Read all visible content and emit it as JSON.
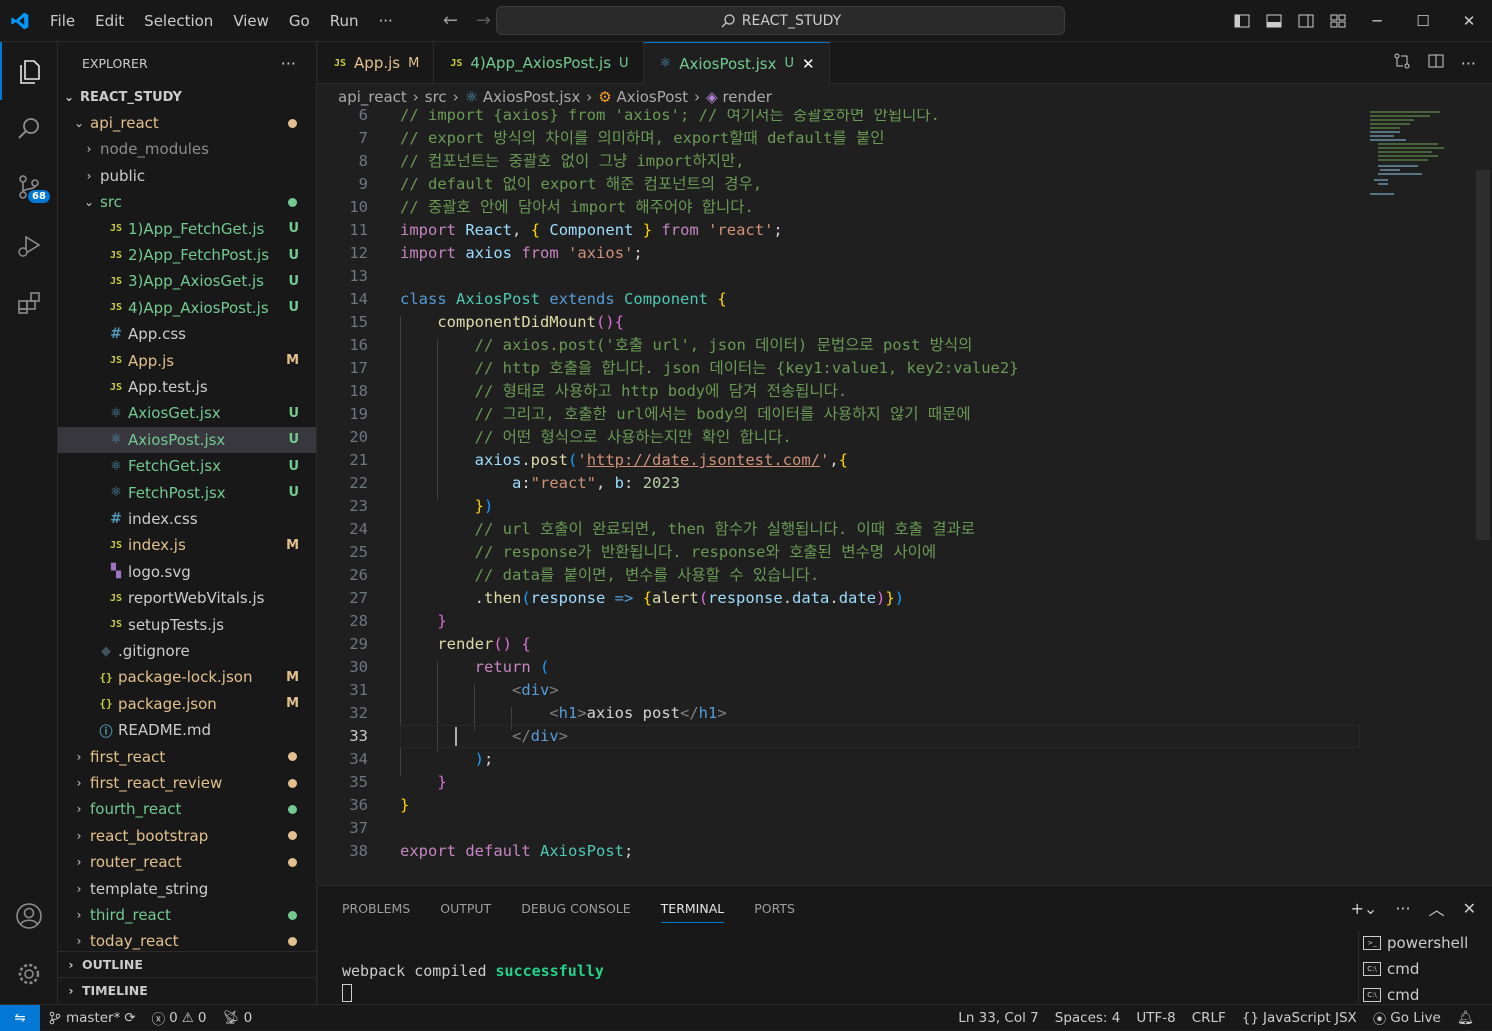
{
  "menu": [
    "File",
    "Edit",
    "Selection",
    "View",
    "Go",
    "Run",
    "···"
  ],
  "search": {
    "text": "REACT_STUDY"
  },
  "activity": {
    "scm_badge": "68"
  },
  "explorer": {
    "title": "EXPLORER",
    "more": "···",
    "root": "REACT_STUDY",
    "tree": [
      {
        "label": "api_react",
        "type": "folder-open",
        "indent": 1,
        "status": "dot",
        "status_color": "#e2c08d",
        "color": "c-m"
      },
      {
        "label": "node_modules",
        "type": "folder",
        "indent": 2,
        "color": "c-dim"
      },
      {
        "label": "public",
        "type": "folder",
        "indent": 2,
        "color": ""
      },
      {
        "label": "src",
        "type": "folder-open",
        "indent": 2,
        "status": "dot",
        "status_color": "#73c991",
        "color": "c-u"
      },
      {
        "label": "1)App_FetchGet.js",
        "type": "js",
        "indent": 3,
        "status": "U",
        "color": "c-u"
      },
      {
        "label": "2)App_FetchPost.js",
        "type": "js",
        "indent": 3,
        "status": "U",
        "color": "c-u"
      },
      {
        "label": "3)App_AxiosGet.js",
        "type": "js",
        "indent": 3,
        "status": "U",
        "color": "c-u"
      },
      {
        "label": "4)App_AxiosPost.js",
        "type": "js",
        "indent": 3,
        "status": "U",
        "color": "c-u"
      },
      {
        "label": "App.css",
        "type": "css",
        "indent": 3,
        "color": ""
      },
      {
        "label": "App.js",
        "type": "js",
        "indent": 3,
        "status": "M",
        "color": "c-m"
      },
      {
        "label": "App.test.js",
        "type": "js-test",
        "indent": 3,
        "color": ""
      },
      {
        "label": "AxiosGet.jsx",
        "type": "react",
        "indent": 3,
        "status": "U",
        "color": "c-u"
      },
      {
        "label": "AxiosPost.jsx",
        "type": "react",
        "indent": 3,
        "status": "U",
        "color": "c-u",
        "selected": true
      },
      {
        "label": "FetchGet.jsx",
        "type": "react",
        "indent": 3,
        "status": "U",
        "color": "c-u"
      },
      {
        "label": "FetchPost.jsx",
        "type": "react",
        "indent": 3,
        "status": "U",
        "color": "c-u"
      },
      {
        "label": "index.css",
        "type": "css",
        "indent": 3,
        "color": ""
      },
      {
        "label": "index.js",
        "type": "js",
        "indent": 3,
        "status": "M",
        "color": "c-m"
      },
      {
        "label": "logo.svg",
        "type": "svg",
        "indent": 3,
        "color": ""
      },
      {
        "label": "reportWebVitals.js",
        "type": "js",
        "indent": 3,
        "color": ""
      },
      {
        "label": "setupTests.js",
        "type": "js",
        "indent": 3,
        "color": ""
      },
      {
        "label": ".gitignore",
        "type": "git",
        "indent": 2,
        "color": ""
      },
      {
        "label": "package-lock.json",
        "type": "json",
        "indent": 2,
        "status": "M",
        "color": "c-m"
      },
      {
        "label": "package.json",
        "type": "json",
        "indent": 2,
        "status": "M",
        "color": "c-m"
      },
      {
        "label": "README.md",
        "type": "info",
        "indent": 2,
        "color": ""
      },
      {
        "label": "first_react",
        "type": "folder",
        "indent": 1,
        "status": "dot",
        "status_color": "#e2c08d",
        "color": "c-m"
      },
      {
        "label": "first_react_review",
        "type": "folder",
        "indent": 1,
        "status": "dot",
        "status_color": "#e2c08d",
        "color": "c-m"
      },
      {
        "label": "fourth_react",
        "type": "folder",
        "indent": 1,
        "status": "dot",
        "status_color": "#73c991",
        "color": "c-u"
      },
      {
        "label": "react_bootstrap",
        "type": "folder",
        "indent": 1,
        "status": "dot",
        "status_color": "#e2c08d",
        "color": "c-m"
      },
      {
        "label": "router_react",
        "type": "folder",
        "indent": 1,
        "status": "dot",
        "status_color": "#e2c08d",
        "color": "c-m"
      },
      {
        "label": "template_string",
        "type": "folder",
        "indent": 1,
        "color": ""
      },
      {
        "label": "third_react",
        "type": "folder",
        "indent": 1,
        "status": "dot",
        "status_color": "#73c991",
        "color": "c-u"
      },
      {
        "label": "today_react",
        "type": "folder",
        "indent": 1,
        "status": "dot",
        "status_color": "#e2c08d",
        "color": "c-m"
      }
    ],
    "outline": "OUTLINE",
    "timeline": "TIMELINE"
  },
  "tabs": [
    {
      "icon": "JS",
      "label": "App.js",
      "status": "M",
      "status_color": "#e2c08d",
      "active": false
    },
    {
      "icon": "JS",
      "label": "4)App_AxiosPost.js",
      "status": "U",
      "status_color": "#73c991",
      "active": false
    },
    {
      "icon": "⚛",
      "label": "AxiosPost.jsx",
      "status": "U",
      "status_color": "#73c991",
      "active": true
    }
  ],
  "breadcrumb": [
    "api_react",
    "src",
    "AxiosPost.jsx",
    "AxiosPost",
    "render"
  ],
  "editor": {
    "current_line": "33",
    "lines": [
      {
        "n": "6",
        "tokens": [
          [
            "t-com",
            "// import {axios} from 'axios'; // 여기서는 중괄호하면 안됩니다."
          ]
        ]
      },
      {
        "n": "7",
        "tokens": [
          [
            "t-com",
            "// export 방식의 차이를 의미하며, export할때 default를 붙인"
          ]
        ]
      },
      {
        "n": "8",
        "tokens": [
          [
            "t-com",
            "// 컴포넌트는 중괄호 없이 그냥 import하지만,"
          ]
        ]
      },
      {
        "n": "9",
        "tokens": [
          [
            "t-com",
            "// default 없이 export 해준 컴포넌트의 경우,"
          ]
        ]
      },
      {
        "n": "10",
        "tokens": [
          [
            "t-com",
            "// 중괄호 안에 담아서 import 해주어야 합니다."
          ]
        ]
      },
      {
        "n": "11",
        "tokens": [
          [
            "t-kwc",
            "import"
          ],
          [
            "t-txt",
            " "
          ],
          [
            "t-var",
            "React"
          ],
          [
            "t-txt",
            ", "
          ],
          [
            "t-p1",
            "{"
          ],
          [
            "t-txt",
            " "
          ],
          [
            "t-var",
            "Component"
          ],
          [
            "t-txt",
            " "
          ],
          [
            "t-p1",
            "}"
          ],
          [
            "t-txt",
            " "
          ],
          [
            "t-kwc",
            "from"
          ],
          [
            "t-txt",
            " "
          ],
          [
            "t-str",
            "'react'"
          ],
          [
            "t-txt",
            ";"
          ]
        ]
      },
      {
        "n": "12",
        "tokens": [
          [
            "t-kwc",
            "import"
          ],
          [
            "t-txt",
            " "
          ],
          [
            "t-var",
            "axios"
          ],
          [
            "t-txt",
            " "
          ],
          [
            "t-kwc",
            "from"
          ],
          [
            "t-txt",
            " "
          ],
          [
            "t-str",
            "'axios'"
          ],
          [
            "t-txt",
            ";"
          ]
        ]
      },
      {
        "n": "13",
        "tokens": []
      },
      {
        "n": "14",
        "tokens": [
          [
            "t-kw",
            "class"
          ],
          [
            "t-txt",
            " "
          ],
          [
            "t-cls",
            "AxiosPost"
          ],
          [
            "t-txt",
            " "
          ],
          [
            "t-kw",
            "extends"
          ],
          [
            "t-txt",
            " "
          ],
          [
            "t-cls",
            "Component"
          ],
          [
            "t-txt",
            " "
          ],
          [
            "t-p1",
            "{"
          ]
        ]
      },
      {
        "n": "15",
        "tokens": [
          [
            "t-txt",
            "    "
          ],
          [
            "t-fn",
            "componentDidMount"
          ],
          [
            "t-p2",
            "()"
          ],
          [
            "t-p2",
            "{"
          ]
        ]
      },
      {
        "n": "16",
        "tokens": [
          [
            "t-txt",
            "        "
          ],
          [
            "t-com",
            "// axios.post('호출 url', json 데이터) 문법으로 post 방식의"
          ]
        ]
      },
      {
        "n": "17",
        "tokens": [
          [
            "t-txt",
            "        "
          ],
          [
            "t-com",
            "// http 호출을 합니다. json 데이터는 {key1:value1, key2:value2}"
          ]
        ]
      },
      {
        "n": "18",
        "tokens": [
          [
            "t-txt",
            "        "
          ],
          [
            "t-com",
            "// 형태로 사용하고 http body에 담겨 전송됩니다."
          ]
        ]
      },
      {
        "n": "19",
        "tokens": [
          [
            "t-txt",
            "        "
          ],
          [
            "t-com",
            "// 그리고, 호출한 url에서는 body의 데이터를 사용하지 않기 때문에"
          ]
        ]
      },
      {
        "n": "20",
        "tokens": [
          [
            "t-txt",
            "        "
          ],
          [
            "t-com",
            "// 어떤 형식으로 사용하는지만 확인 합니다."
          ]
        ]
      },
      {
        "n": "21",
        "tokens": [
          [
            "t-txt",
            "        "
          ],
          [
            "t-var",
            "axios"
          ],
          [
            "t-txt",
            "."
          ],
          [
            "t-fn",
            "post"
          ],
          [
            "t-p3",
            "("
          ],
          [
            "t-str",
            "'"
          ],
          [
            "t-link",
            "http://date.jsontest.com/"
          ],
          [
            "t-str",
            "'"
          ],
          [
            "t-txt",
            ","
          ],
          [
            "t-p1",
            "{"
          ]
        ]
      },
      {
        "n": "22",
        "tokens": [
          [
            "t-txt",
            "            "
          ],
          [
            "t-var",
            "a"
          ],
          [
            "t-txt",
            ":"
          ],
          [
            "t-str",
            "\"react\""
          ],
          [
            "t-txt",
            ", "
          ],
          [
            "t-var",
            "b"
          ],
          [
            "t-txt",
            ": "
          ],
          [
            "t-num",
            "2023"
          ]
        ]
      },
      {
        "n": "23",
        "tokens": [
          [
            "t-txt",
            "        "
          ],
          [
            "t-p1",
            "}"
          ],
          [
            "t-p3",
            ")"
          ]
        ]
      },
      {
        "n": "24",
        "tokens": [
          [
            "t-txt",
            "        "
          ],
          [
            "t-com",
            "// url 호출이 완료되면, then 함수가 실행됩니다. 이때 호출 결과로"
          ]
        ]
      },
      {
        "n": "25",
        "tokens": [
          [
            "t-txt",
            "        "
          ],
          [
            "t-com",
            "// response가 반환됩니다. response와 호출된 변수명 사이에"
          ]
        ]
      },
      {
        "n": "26",
        "tokens": [
          [
            "t-txt",
            "        "
          ],
          [
            "t-com",
            "// data를 붙이면, 변수를 사용할 수 있습니다."
          ]
        ]
      },
      {
        "n": "27",
        "tokens": [
          [
            "t-txt",
            "        ."
          ],
          [
            "t-fn",
            "then"
          ],
          [
            "t-p3",
            "("
          ],
          [
            "t-var",
            "response"
          ],
          [
            "t-txt",
            " "
          ],
          [
            "t-kw",
            "=>"
          ],
          [
            "t-txt",
            " "
          ],
          [
            "t-p1",
            "{"
          ],
          [
            "t-fn",
            "alert"
          ],
          [
            "t-p2",
            "("
          ],
          [
            "t-var",
            "response"
          ],
          [
            "t-txt",
            "."
          ],
          [
            "t-var",
            "data"
          ],
          [
            "t-txt",
            "."
          ],
          [
            "t-var",
            "date"
          ],
          [
            "t-p2",
            ")"
          ],
          [
            "t-p1",
            "}"
          ],
          [
            "t-p3",
            ")"
          ]
        ]
      },
      {
        "n": "28",
        "tokens": [
          [
            "t-txt",
            "    "
          ],
          [
            "t-p2",
            "}"
          ]
        ]
      },
      {
        "n": "29",
        "tokens": [
          [
            "t-txt",
            "    "
          ],
          [
            "t-fn",
            "render"
          ],
          [
            "t-p2",
            "()"
          ],
          [
            "t-txt",
            " "
          ],
          [
            "t-p2",
            "{"
          ]
        ]
      },
      {
        "n": "30",
        "tokens": [
          [
            "t-txt",
            "        "
          ],
          [
            "t-kwc",
            "return"
          ],
          [
            "t-txt",
            " "
          ],
          [
            "t-p3",
            "("
          ]
        ]
      },
      {
        "n": "31",
        "tokens": [
          [
            "t-txt",
            "            "
          ],
          [
            "t-tagp",
            "<"
          ],
          [
            "t-tag",
            "div"
          ],
          [
            "t-tagp",
            ">"
          ]
        ]
      },
      {
        "n": "32",
        "tokens": [
          [
            "t-txt",
            "                "
          ],
          [
            "t-tagp",
            "<"
          ],
          [
            "t-tag",
            "h1"
          ],
          [
            "t-tagp",
            ">"
          ],
          [
            "t-txt",
            "axios post"
          ],
          [
            "t-tagp",
            "</"
          ],
          [
            "t-tag",
            "h1"
          ],
          [
            "t-tagp",
            ">"
          ]
        ]
      },
      {
        "n": "33",
        "tokens": [
          [
            "t-txt",
            "            "
          ],
          [
            "t-tagp",
            "</"
          ],
          [
            "t-tag",
            "div"
          ],
          [
            "t-tagp",
            ">"
          ]
        ]
      },
      {
        "n": "34",
        "tokens": [
          [
            "t-txt",
            "        "
          ],
          [
            "t-p3",
            ")"
          ],
          [
            "t-txt",
            ";"
          ]
        ]
      },
      {
        "n": "35",
        "tokens": [
          [
            "t-txt",
            "    "
          ],
          [
            "t-p2",
            "}"
          ]
        ]
      },
      {
        "n": "36",
        "tokens": [
          [
            "t-p1",
            "}"
          ]
        ]
      },
      {
        "n": "37",
        "tokens": []
      },
      {
        "n": "38",
        "tokens": [
          [
            "t-kwc",
            "export"
          ],
          [
            "t-txt",
            " "
          ],
          [
            "t-kwc",
            "default"
          ],
          [
            "t-txt",
            " "
          ],
          [
            "t-cls",
            "AxiosPost"
          ],
          [
            "t-txt",
            ";"
          ]
        ]
      }
    ]
  },
  "panel": {
    "tabs": [
      "PROBLEMS",
      "OUTPUT",
      "DEBUG CONSOLE",
      "TERMINAL",
      "PORTS"
    ],
    "active_tab": "TERMINAL",
    "terminal_text_prefix": "webpack compiled ",
    "terminal_text_success": "successfully",
    "terminals": [
      "powershell",
      "cmd",
      "cmd"
    ]
  },
  "statusbar": {
    "branch": "master*",
    "errors": "0",
    "warnings": "0",
    "ports": "0",
    "position": "Ln 33, Col 7",
    "spaces": "Spaces: 4",
    "encoding": "UTF-8",
    "eol": "CRLF",
    "language": "JavaScript JSX",
    "golive": "Go Live"
  }
}
